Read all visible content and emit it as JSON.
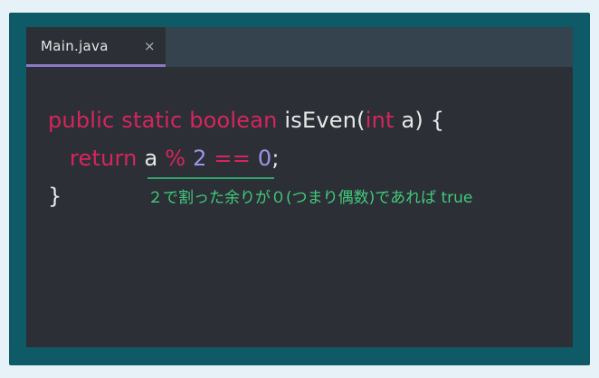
{
  "tab": {
    "title": "Main.java",
    "close": "×"
  },
  "code": {
    "line1": {
      "kw1": "public",
      "kw2": "static",
      "kw3": "boolean",
      "method": "isEven(",
      "kw4": "int",
      "rest": "a) {"
    },
    "line2": {
      "kw_return": "return",
      "var": "a",
      "op_mod": "%",
      "num2": "2",
      "op_eq": "==",
      "num0": "0",
      "semi": ";"
    },
    "line3": {
      "brace": "}"
    }
  },
  "annotation": {
    "text": "２で割った余りが０(つまり偶数)であれば true"
  }
}
